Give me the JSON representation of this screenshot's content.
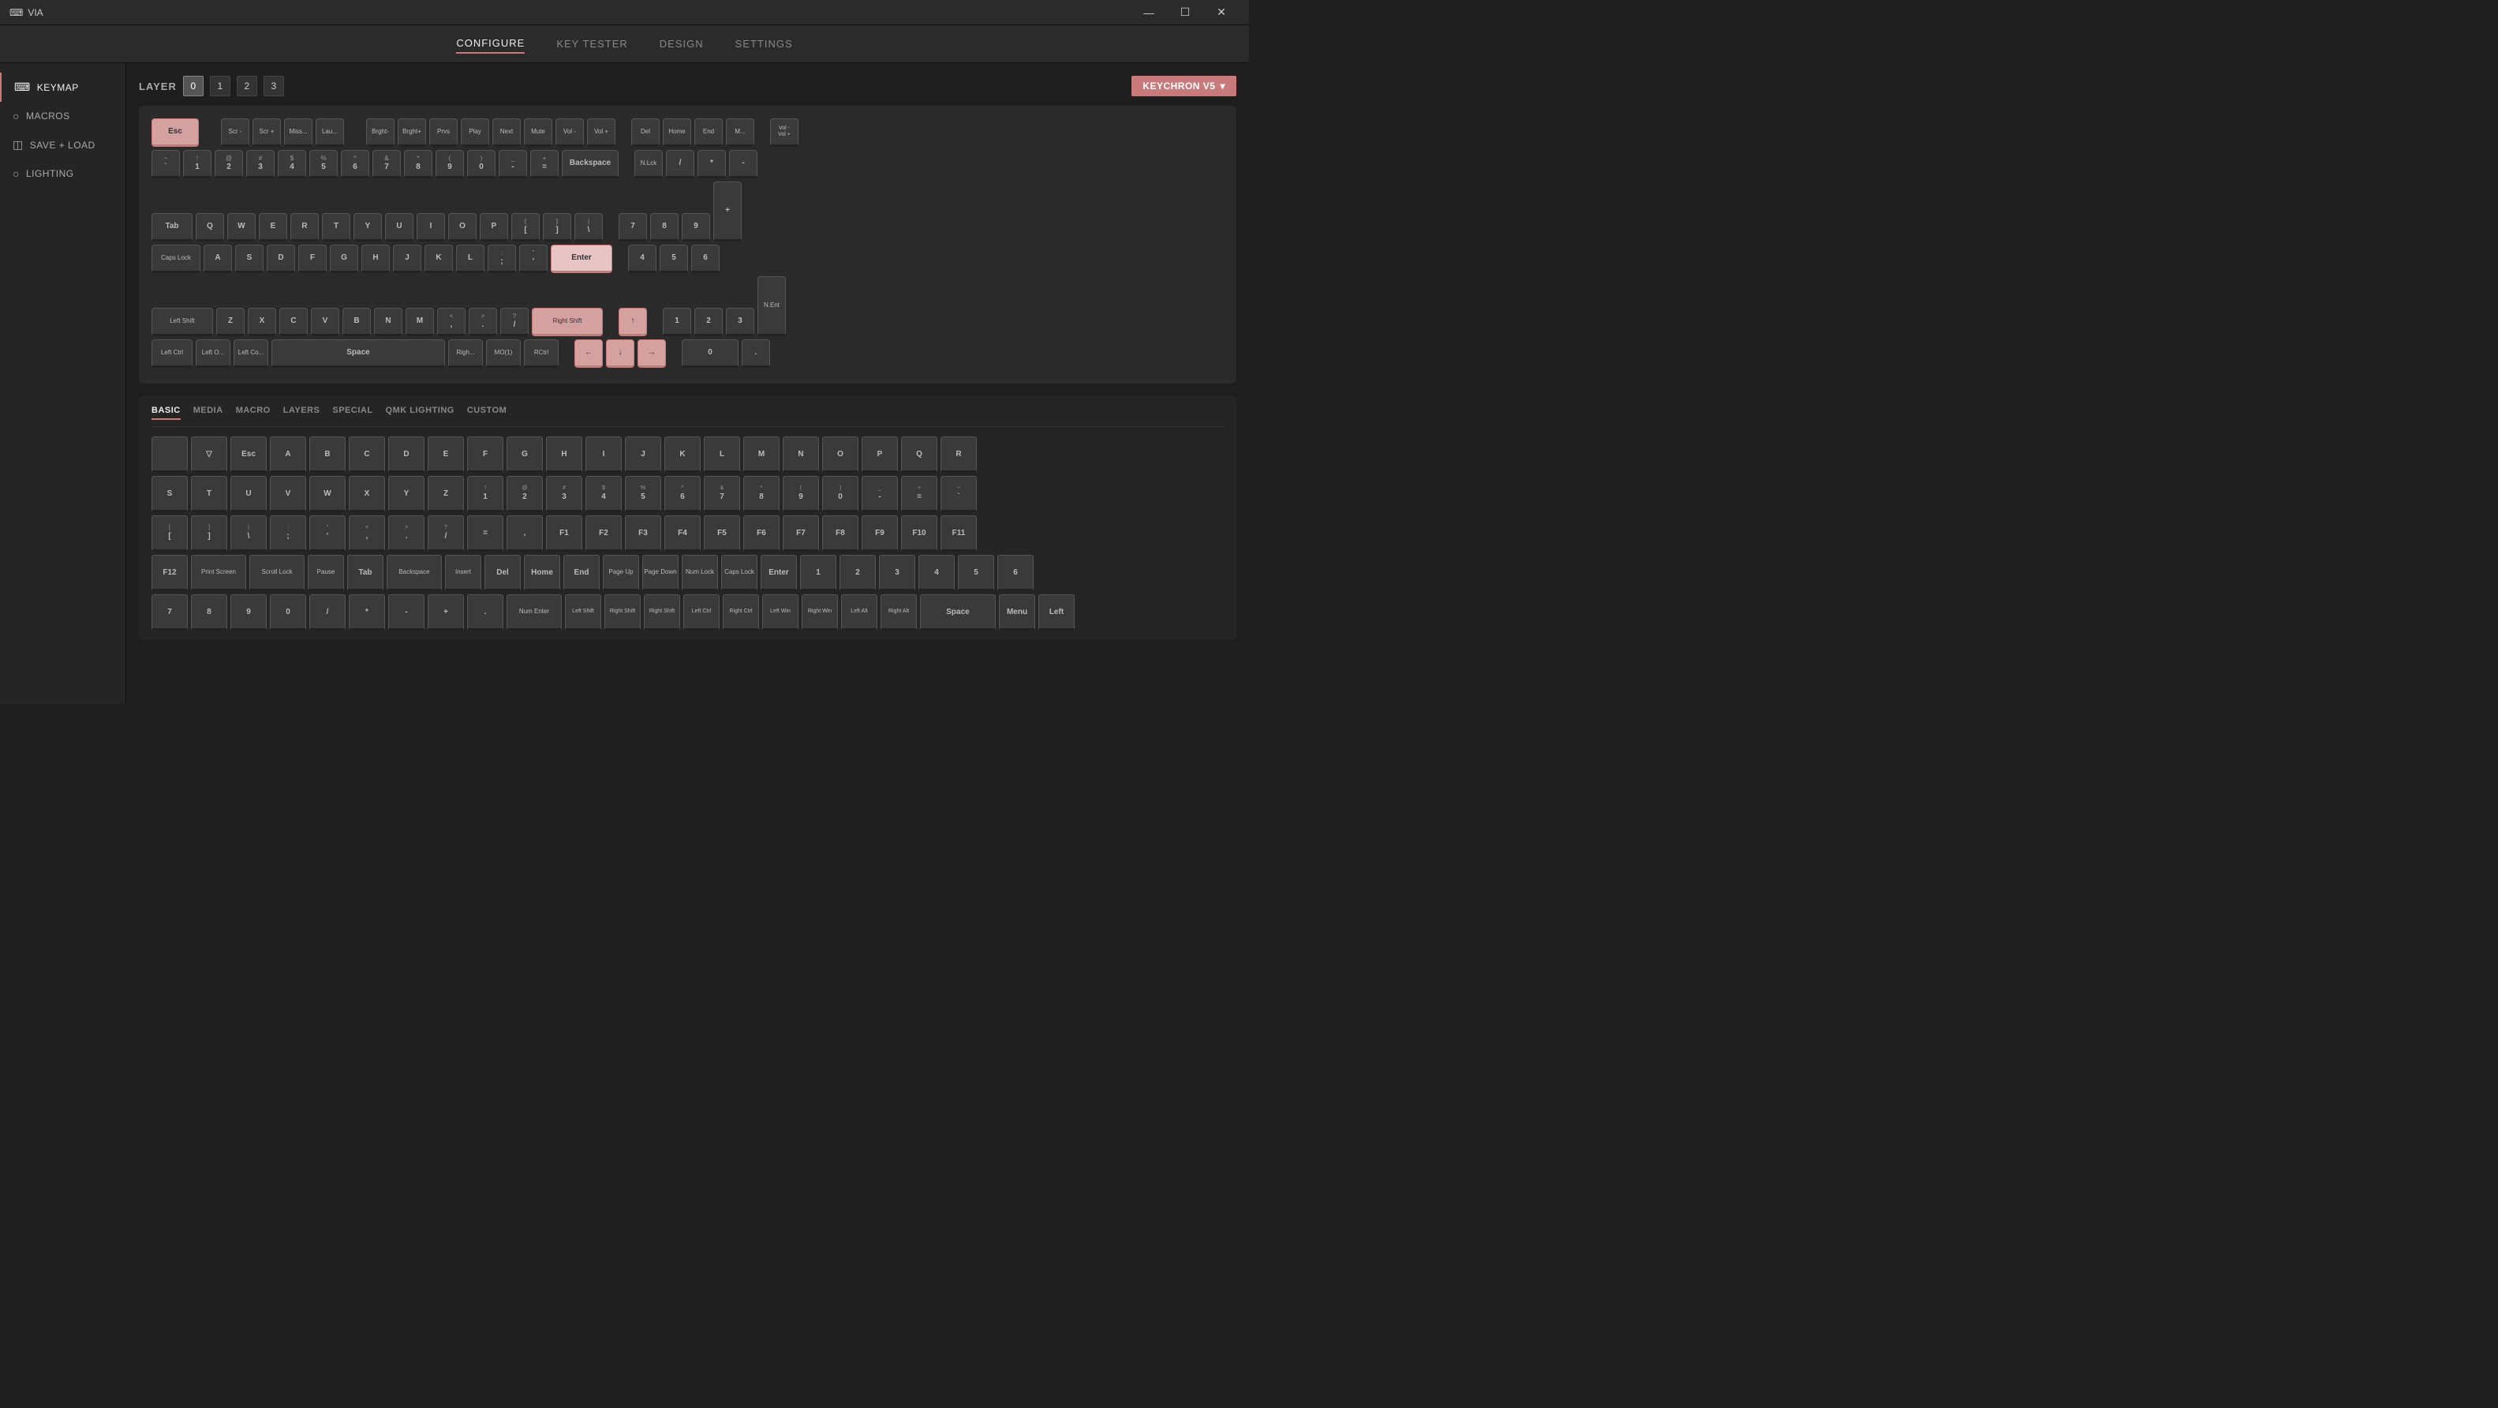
{
  "app": {
    "title": "VIA"
  },
  "titlebar": {
    "title": "VIA",
    "minimize": "—",
    "maximize": "☐",
    "close": "✕"
  },
  "nav": {
    "items": [
      {
        "label": "CONFIGURE",
        "active": true
      },
      {
        "label": "KEY TESTER",
        "active": false
      },
      {
        "label": "DESIGN",
        "active": false
      },
      {
        "label": "SETTINGS",
        "active": false
      }
    ]
  },
  "sidebar": {
    "items": [
      {
        "label": "KEYMAP",
        "icon": "⌨",
        "active": true
      },
      {
        "label": "MACROS",
        "icon": "○",
        "active": false
      },
      {
        "label": "SAVE + LOAD",
        "icon": "💾",
        "active": false
      },
      {
        "label": "LIGHTING",
        "icon": "○",
        "active": false
      }
    ]
  },
  "layer": {
    "label": "LAYER",
    "buttons": [
      "0",
      "1",
      "2",
      "3"
    ],
    "active": 0
  },
  "keyboard_selector": {
    "label": "KEYCHRON V5",
    "chevron": "▾"
  },
  "keyboard": {
    "rows": {
      "fn_row": [
        "Esc",
        "Scr-",
        "Scr+",
        "Miss...",
        "Lau...",
        "",
        "Brght-",
        "Brght+",
        "Prvs",
        "Play",
        "Next",
        "Mute",
        "Vol -",
        "Vol +",
        "Del",
        "Home",
        "End",
        "M...",
        "Vol -",
        "Vol +"
      ],
      "num_row": [
        "~`",
        "!1",
        "@2",
        "#3",
        "$4",
        "%5",
        "^6",
        "&7",
        "*8",
        "(9",
        ")0",
        "_-",
        "+=",
        "",
        "Backspace",
        "",
        "N.Lck",
        "/",
        "*",
        "-"
      ],
      "tab_row": [
        "Tab",
        "Q",
        "W",
        "E",
        "R",
        "T",
        "Y",
        "U",
        "I",
        "O",
        "P",
        "{[",
        "}]",
        "|\\",
        "",
        "7",
        "8",
        "9",
        "+"
      ],
      "caps_row": [
        "Caps Lock",
        "A",
        "S",
        "D",
        "F",
        "G",
        "H",
        "J",
        "K",
        "L",
        ":;",
        "'\"",
        "Enter",
        "",
        "",
        "4",
        "5",
        "6"
      ],
      "shift_row": [
        "Left Shift",
        "Z",
        "X",
        "C",
        "V",
        "B",
        "N",
        "M",
        "<,",
        ">.",
        "?/",
        "Right Shift",
        "",
        "",
        "↑",
        "",
        "1",
        "2",
        "3",
        "N.Ent"
      ],
      "ctrl_row": [
        "Left Ctrl",
        "Left O...",
        "Left Co...",
        "Space",
        "",
        "Righ...",
        "MO(1)",
        "RCtrl",
        "",
        "←",
        "↓",
        "→",
        "",
        "0",
        "."
      ]
    }
  },
  "key_picker": {
    "nav": [
      "BASIC",
      "MEDIA",
      "MACRO",
      "LAYERS",
      "SPECIAL",
      "QMK LIGHTING",
      "CUSTOM"
    ],
    "active_nav": "BASIC",
    "row1": [
      {
        "top": "",
        "main": ""
      },
      {
        "top": "",
        "main": "▽"
      },
      {
        "top": "",
        "main": "Esc"
      },
      {
        "top": "",
        "main": "A"
      },
      {
        "top": "",
        "main": "B"
      },
      {
        "top": "",
        "main": "C"
      },
      {
        "top": "",
        "main": "D"
      },
      {
        "top": "",
        "main": "E"
      },
      {
        "top": "",
        "main": "F"
      },
      {
        "top": "",
        "main": "G"
      },
      {
        "top": "",
        "main": "H"
      },
      {
        "top": "",
        "main": "I"
      },
      {
        "top": "",
        "main": "J"
      },
      {
        "top": "",
        "main": "K"
      },
      {
        "top": "",
        "main": "L"
      },
      {
        "top": "",
        "main": "M"
      },
      {
        "top": "",
        "main": "N"
      },
      {
        "top": "",
        "main": "O"
      },
      {
        "top": "",
        "main": "P"
      },
      {
        "top": "",
        "main": "Q"
      },
      {
        "top": "",
        "main": "R"
      }
    ],
    "row2": [
      {
        "top": "",
        "main": "S"
      },
      {
        "top": "",
        "main": "T"
      },
      {
        "top": "",
        "main": "U"
      },
      {
        "top": "",
        "main": "V"
      },
      {
        "top": "",
        "main": "W"
      },
      {
        "top": "",
        "main": "X"
      },
      {
        "top": "",
        "main": "Y"
      },
      {
        "top": "",
        "main": "Z"
      },
      {
        "top": "!",
        "main": "1"
      },
      {
        "top": "@",
        "main": "2"
      },
      {
        "top": "#",
        "main": "3"
      },
      {
        "top": "$",
        "main": "4"
      },
      {
        "top": "%",
        "main": "5"
      },
      {
        "top": "^",
        "main": "6"
      },
      {
        "top": "&",
        "main": "7"
      },
      {
        "top": "*",
        "main": "8"
      },
      {
        "top": "(",
        "main": "9"
      },
      {
        "top": ")",
        "main": "0"
      },
      {
        "top": "_",
        "main": "-"
      },
      {
        "top": "+",
        "main": "="
      },
      {
        "top": "~",
        "main": "`"
      }
    ],
    "row3": [
      {
        "top": "[",
        "main": "["
      },
      {
        "top": "]",
        "main": "]"
      },
      {
        "top": "|",
        "main": "\\"
      },
      {
        "top": ":",
        "main": ";"
      },
      {
        "top": "\"",
        "main": "'"
      },
      {
        "top": "<",
        "main": ","
      },
      {
        "top": ">",
        "main": "."
      },
      {
        "top": "?",
        "main": "/"
      },
      {
        "top": "",
        "main": "="
      },
      {
        "top": "",
        "main": ","
      },
      {
        "top": "",
        "main": "F1"
      },
      {
        "top": "",
        "main": "F2"
      },
      {
        "top": "",
        "main": "F3"
      },
      {
        "top": "",
        "main": "F4"
      },
      {
        "top": "",
        "main": "F5"
      },
      {
        "top": "",
        "main": "F6"
      },
      {
        "top": "",
        "main": "F7"
      },
      {
        "top": "",
        "main": "F8"
      },
      {
        "top": "",
        "main": "F9"
      },
      {
        "top": "",
        "main": "F10"
      },
      {
        "top": "",
        "main": "F11"
      }
    ],
    "row4": [
      {
        "top": "",
        "main": "F12",
        "wide": false
      },
      {
        "top": "",
        "main": "Print Screen",
        "wide": true
      },
      {
        "top": "",
        "main": "Scroll Lock",
        "wide": true
      },
      {
        "top": "",
        "main": "Pause",
        "wide": false
      },
      {
        "top": "",
        "main": "Tab",
        "wide": false
      },
      {
        "top": "",
        "main": "Backspace",
        "wide": true
      },
      {
        "top": "",
        "main": "Insert",
        "wide": false
      },
      {
        "top": "",
        "main": "Del",
        "wide": false
      },
      {
        "top": "",
        "main": "Home",
        "wide": false
      },
      {
        "top": "",
        "main": "End",
        "wide": false
      },
      {
        "top": "",
        "main": "Page Up",
        "wide": false
      },
      {
        "top": "",
        "main": "Page Down",
        "wide": false
      },
      {
        "top": "",
        "main": "Num Lock",
        "wide": false
      },
      {
        "top": "",
        "main": "Caps Lock",
        "wide": false
      },
      {
        "top": "",
        "main": "Enter",
        "wide": false
      },
      {
        "top": "",
        "main": "1",
        "wide": false
      },
      {
        "top": "",
        "main": "2",
        "wide": false
      },
      {
        "top": "",
        "main": "3",
        "wide": false
      },
      {
        "top": "",
        "main": "4",
        "wide": false
      },
      {
        "top": "",
        "main": "5",
        "wide": false
      },
      {
        "top": "",
        "main": "6",
        "wide": false
      }
    ],
    "row5": [
      {
        "top": "",
        "main": "7"
      },
      {
        "top": "",
        "main": "8"
      },
      {
        "top": "",
        "main": "9"
      },
      {
        "top": "",
        "main": "0"
      },
      {
        "top": "",
        "main": "/"
      },
      {
        "top": "",
        "main": "*"
      },
      {
        "top": "",
        "main": "-"
      },
      {
        "top": "",
        "main": "+"
      },
      {
        "top": "",
        "main": "."
      },
      {
        "top": "",
        "main": "Num Enter",
        "wide": true
      },
      {
        "top": "",
        "main": "Left Shift",
        "wide": false
      },
      {
        "top": "",
        "main": "Right Shift",
        "wide": false
      },
      {
        "top": "",
        "main": "Right Shift",
        "wide": false
      },
      {
        "top": "",
        "main": "Left Ctrl",
        "wide": false
      },
      {
        "top": "",
        "main": "Right Ctrl",
        "wide": false
      },
      {
        "top": "",
        "main": "Left Win",
        "wide": false
      },
      {
        "top": "",
        "main": "Right Win",
        "wide": false
      },
      {
        "top": "",
        "main": "Left Alt",
        "wide": false
      },
      {
        "top": "",
        "main": "Right Alt",
        "wide": false
      },
      {
        "top": "",
        "main": "Space",
        "wide": true
      },
      {
        "top": "",
        "main": "Menu"
      },
      {
        "top": "",
        "main": "Left"
      }
    ]
  }
}
